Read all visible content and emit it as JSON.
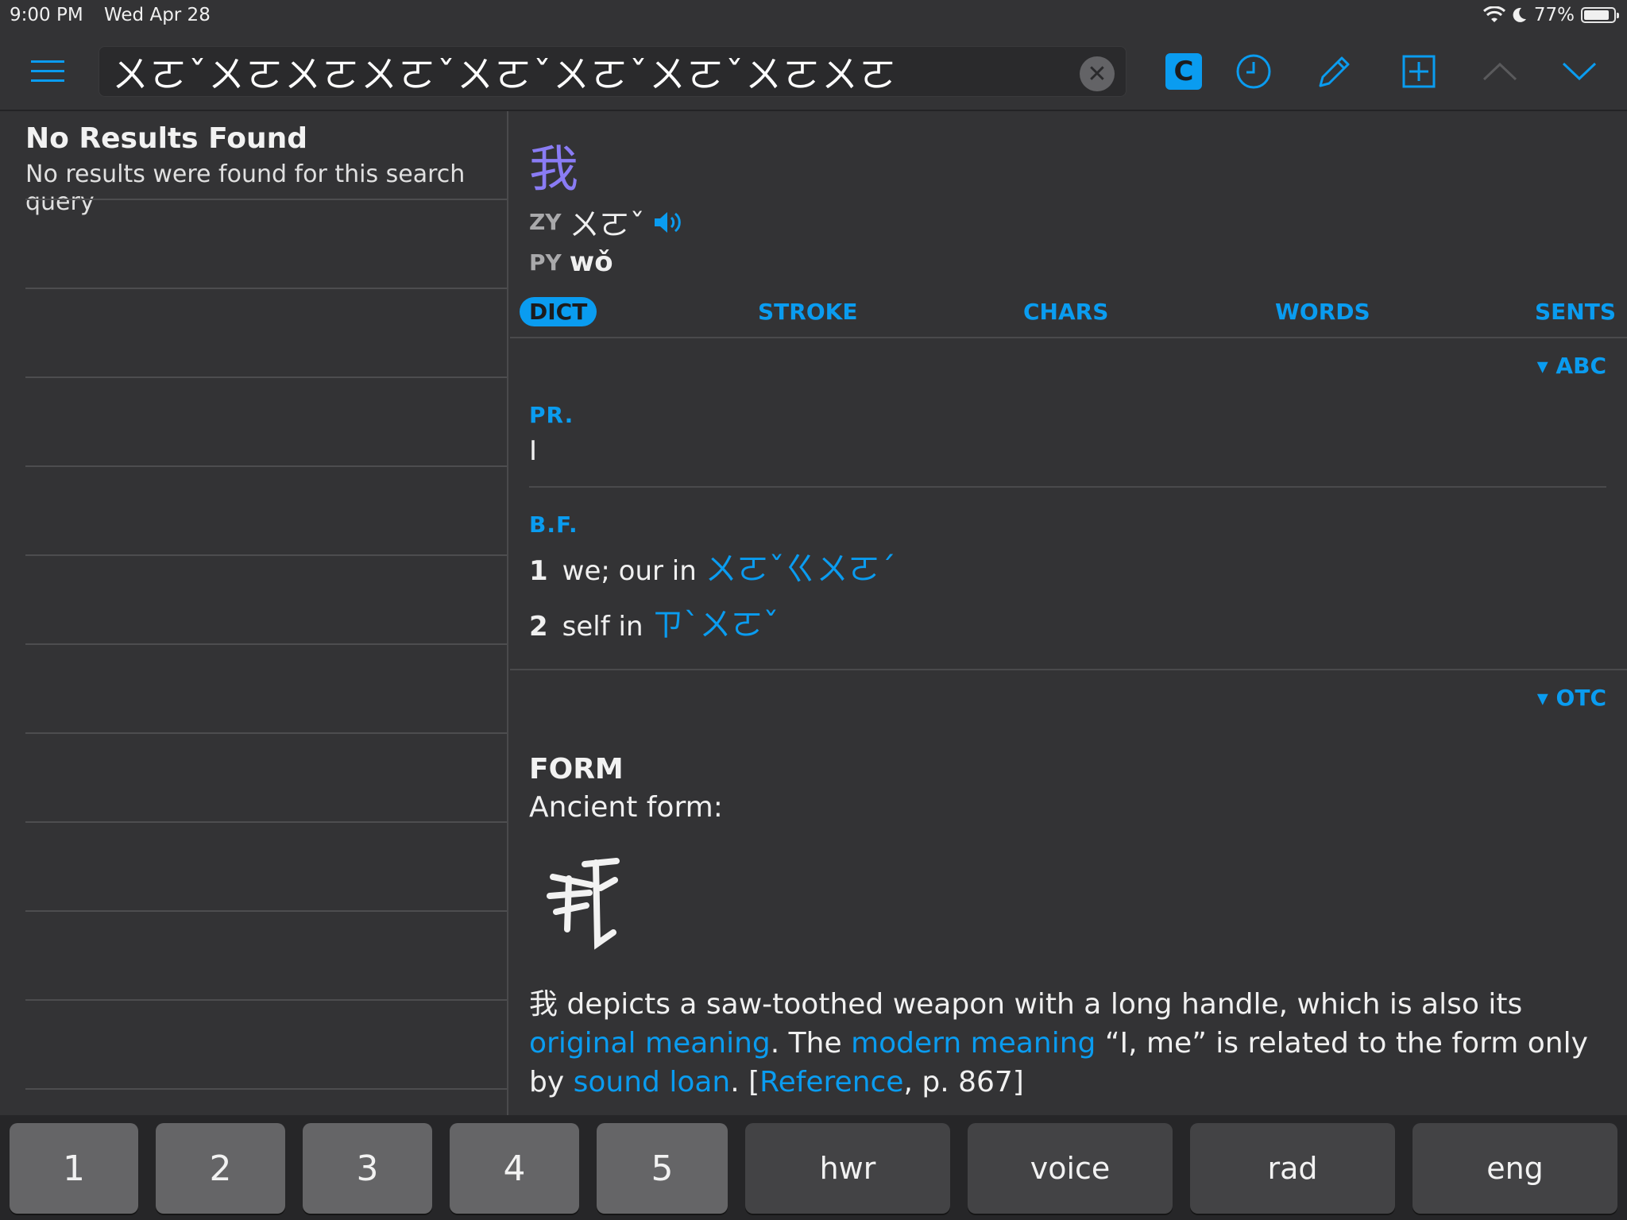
{
  "status_bar": {
    "time": "9:00 PM",
    "date": "Wed Apr 28",
    "battery": "77%",
    "battery_level": 0.77
  },
  "toolbar": {
    "search_value": "ㄨㄛˇㄨㄛㄨㄛㄨㄛˇㄨㄛˇㄨㄛˇㄨㄛˇㄨㄛㄨㄛ",
    "c_button_label": "C",
    "icons": [
      "menu-icon",
      "clear-icon",
      "clipboard-c-icon",
      "history-clock-icon",
      "pencil-icon",
      "add-box-icon",
      "chevron-up-icon",
      "chevron-down-icon"
    ]
  },
  "results": {
    "title": "No Results Found",
    "subtitle": "No results were found for this search query"
  },
  "entry": {
    "headword": "我",
    "zy_tag": "ZY",
    "zhuyin": "ㄨㄛˇ",
    "py_tag": "PY",
    "pinyin": "wǒ",
    "tabs": [
      "DICT",
      "STROKE",
      "CHARS",
      "WORDS",
      "SENTS"
    ],
    "active_tab": "DICT",
    "abc_toggle": "▾ ABC",
    "pos1": "PR.",
    "pos1_def": "I",
    "pos2": "B.F.",
    "senses": [
      {
        "num": "1",
        "text": "we; our in",
        "link": "ㄨㄛˇㄍㄨㄛˊ"
      },
      {
        "num": "2",
        "text": "self in",
        "link": "ㄗˋㄨㄛˇ"
      }
    ],
    "otc_toggle": "▾ OTC",
    "form_title": "FORM",
    "form_subtitle": "Ancient form:",
    "para": {
      "p1": "我 depicts a saw-toothed weapon with a long handle, which is also its ",
      "l1": "original meaning",
      "p2": ". The ",
      "l2": "modern meaning",
      "p3": " “I, me” is related to the form only by ",
      "l3": "sound loan",
      "p4": ". [",
      "l4": "Reference",
      "p5": ", p. 867]"
    }
  },
  "keyboard": {
    "keys": [
      "1",
      "2",
      "3",
      "4",
      "5",
      "hwr",
      "voice",
      "rad",
      "eng"
    ]
  }
}
